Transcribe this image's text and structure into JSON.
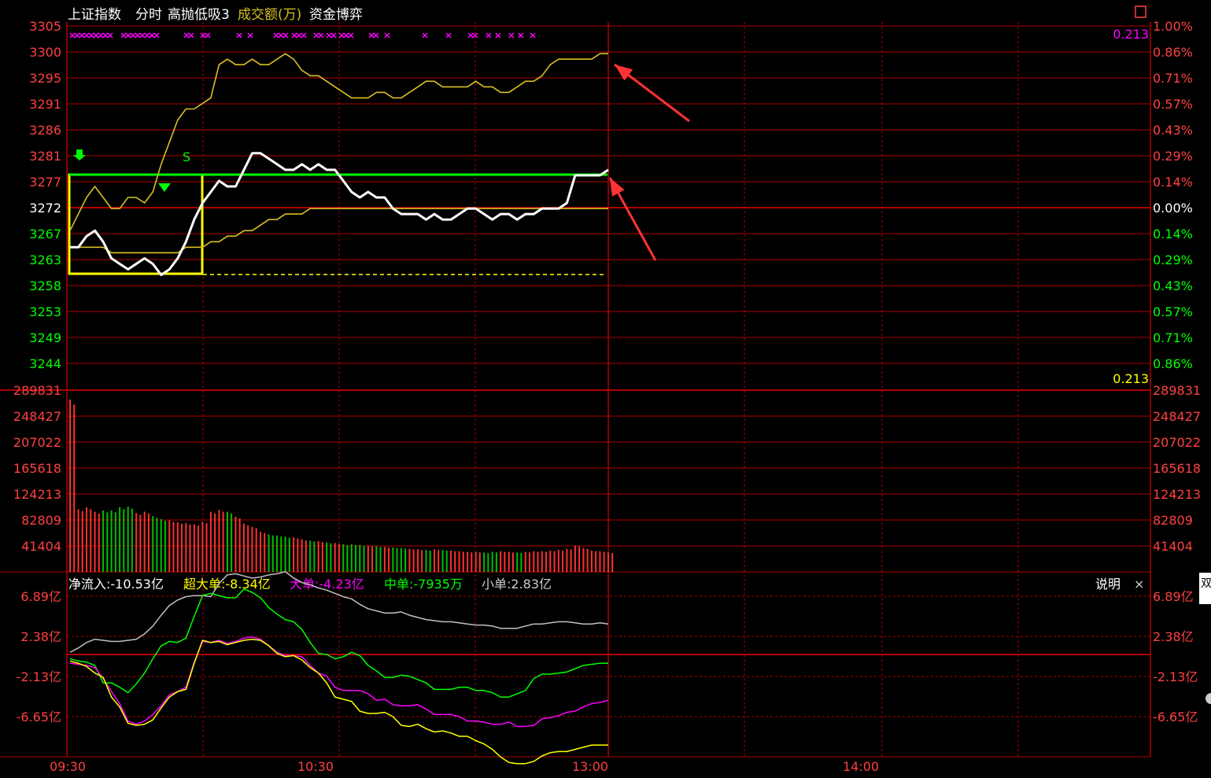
{
  "header": {
    "index_name": "上证指数",
    "mode": "分时",
    "indicator": "高抛低吸3",
    "volume_label": "成交额(万)",
    "indicator2": "资金博弈",
    "corner_icon": "restore-icon"
  },
  "price_panel": {
    "left_ticks": [
      "3305",
      "3300",
      "3295",
      "3291",
      "3286",
      "3281",
      "3277",
      "3272",
      "3267",
      "3263",
      "3258",
      "3253",
      "3249",
      "3244"
    ],
    "right_ticks": [
      "1.00%",
      "0.86%",
      "0.71%",
      "0.57%",
      "0.43%",
      "0.29%",
      "0.14%",
      "0.00%",
      "0.14%",
      "0.29%",
      "0.43%",
      "0.57%",
      "0.71%",
      "0.86%"
    ],
    "indicator_value_top": "0.213",
    "indicator_value_mid": "0.213",
    "signal_s": "S"
  },
  "volume_panel": {
    "ticks": [
      "289831",
      "248427",
      "207022",
      "165618",
      "124213",
      "82809",
      "41404"
    ]
  },
  "flow_panel": {
    "legend": {
      "net": "净流入:-10.53亿",
      "super": "超大单:-8.34亿",
      "large": "大单:-4.23亿",
      "medium": "中单:-7935万",
      "small": "小单:2.83亿"
    },
    "ticks": [
      "6.89亿",
      "2.38亿",
      "-2.13亿",
      "-6.65亿"
    ],
    "explain_label": "说明",
    "close_label": "×",
    "edge_label": "双"
  },
  "time_axis": [
    "09:30",
    "10:30",
    "13:00",
    "14:00"
  ],
  "colors": {
    "grid": "#b00000",
    "price_line": "#ffffff",
    "avg_line": "#d8c020",
    "index_line": "#d8c020",
    "green": "#00ff00",
    "yellow": "#ffff00",
    "magenta": "#ff00ff",
    "red_text": "#ff4040",
    "volume_up": "#ff3030",
    "volume_down": "#00c000",
    "flow_gray": "#c0c0c0",
    "arrow": "#ff3333"
  },
  "chart_data": {
    "type": "line",
    "title": "上证指数 分时",
    "x_labels": [
      "09:30",
      "10:30",
      "13:00",
      "14:00"
    ],
    "price_range": [
      3244,
      3305
    ],
    "base_price": 3272,
    "series": [
      {
        "name": "price",
        "values": [
          3265,
          3265,
          3267,
          3268,
          3266,
          3263,
          3262,
          3261,
          3262,
          3263,
          3262,
          3260,
          3261,
          3263,
          3266,
          3270,
          3273,
          3275,
          3277,
          3276,
          3276,
          3279,
          3282,
          3282,
          3281,
          3280,
          3279,
          3279,
          3280,
          3279,
          3280,
          3279,
          3279,
          3277,
          3275,
          3274,
          3275,
          3274,
          3274,
          3272,
          3271,
          3271,
          3271,
          3270,
          3271,
          3270,
          3270,
          3271,
          3272,
          3272,
          3271,
          3270,
          3271,
          3271,
          3270,
          3271,
          3271,
          3272,
          3272,
          3272,
          3273,
          3278,
          3278,
          3278,
          3278,
          3279
        ]
      },
      {
        "name": "avg",
        "values": [
          3265,
          3265,
          3265,
          3265,
          3265,
          3264,
          3264,
          3264,
          3264,
          3264,
          3264,
          3264,
          3264,
          3264,
          3265,
          3265,
          3265,
          3266,
          3266,
          3267,
          3267,
          3268,
          3268,
          3269,
          3270,
          3270,
          3271,
          3271,
          3271,
          3272,
          3272,
          3272,
          3272,
          3272,
          3272,
          3272,
          3272,
          3272,
          3272,
          3272,
          3272,
          3272,
          3272,
          3272,
          3272,
          3272,
          3272,
          3272,
          3272,
          3272,
          3272,
          3272,
          3272,
          3272,
          3272,
          3272,
          3272,
          3272,
          3272,
          3272,
          3272,
          3272,
          3272,
          3272,
          3272,
          3272
        ]
      },
      {
        "name": "indicator",
        "values": [
          3268,
          3271,
          3274,
          3276,
          3274,
          3272,
          3272,
          3274,
          3274,
          3273,
          3275,
          3280,
          3284,
          3288,
          3290,
          3290,
          3291,
          3292,
          3298,
          3299,
          3298,
          3298,
          3299,
          3298,
          3298,
          3299,
          3300,
          3299,
          3297,
          3296,
          3296,
          3295,
          3294,
          3293,
          3292,
          3292,
          3292,
          3293,
          3293,
          3292,
          3292,
          3293,
          3294,
          3295,
          3295,
          3294,
          3294,
          3294,
          3294,
          3295,
          3294,
          3294,
          3293,
          3293,
          3294,
          3295,
          3295,
          3296,
          3298,
          3299,
          3299,
          3299,
          3299,
          3299,
          3300,
          3300
        ]
      }
    ],
    "volume": [
      275000,
      100000,
      103000,
      96000,
      98000,
      98000,
      103000,
      104000,
      94000,
      96000,
      89000,
      84000,
      82000,
      79000,
      78000,
      76000,
      80000,
      96000,
      99000,
      96000,
      88000,
      77000,
      72000,
      64000,
      60000,
      58000,
      56000,
      55000,
      52000,
      50000,
      49000,
      47000,
      46000,
      44000,
      44000,
      43000,
      42000,
      41000,
      40000,
      39000,
      38000,
      37000,
      36000,
      35000,
      36000,
      35000,
      34000,
      33000,
      32000,
      32000,
      31000,
      32000,
      33000,
      32000,
      31000,
      32000,
      33000,
      33000,
      34000,
      35000,
      37000,
      42000,
      38000,
      34000,
      33000,
      31000
    ],
    "volume_ticks": [
      41404,
      82809,
      124213,
      165618,
      207022,
      248427,
      289831
    ],
    "flow_range": [
      -9,
      9
    ],
    "flow_series": [
      {
        "name": "小单",
        "values": [
          0.2,
          0.6,
          1.1,
          1.4,
          1.3,
          1.2,
          1.2,
          1.3,
          1.4,
          1.9,
          2.6,
          3.6,
          4.5,
          5.0,
          5.3,
          5.4,
          5.4,
          5.3,
          6.5,
          7.3,
          7.4,
          7.2,
          7.0,
          7.1,
          7.3,
          7.4,
          7.6,
          7.0,
          6.6,
          6.4,
          6.1,
          5.9,
          5.6,
          5.3,
          5.1,
          4.6,
          4.2,
          4.0,
          3.8,
          3.8,
          3.9,
          3.6,
          3.4,
          3.2,
          3.1,
          3.0,
          3.0,
          2.9,
          2.8,
          2.7,
          2.7,
          2.6,
          2.4,
          2.4,
          2.4,
          2.6,
          2.8,
          2.8,
          2.9,
          3.0,
          3.0,
          2.9,
          2.8,
          2.8,
          2.9,
          2.8
        ]
      },
      {
        "name": "中单",
        "values": [
          -0.4,
          -0.6,
          -0.7,
          -1.0,
          -2.6,
          -2.6,
          -3.0,
          -3.5,
          -2.7,
          -1.7,
          -0.4,
          0.8,
          1.2,
          1.1,
          1.5,
          3.5,
          5.4,
          5.6,
          5.4,
          5.2,
          5.2,
          6.0,
          5.7,
          5.2,
          4.3,
          3.7,
          3.2,
          3.0,
          2.3,
          1.1,
          0.1,
          0.0,
          -0.4,
          -0.2,
          0.2,
          -0.1,
          -1.0,
          -1.5,
          -2.1,
          -2.1,
          -1.9,
          -2.0,
          -2.3,
          -2.6,
          -3.2,
          -3.2,
          -3.2,
          -3.0,
          -3.0,
          -3.3,
          -3.3,
          -3.5,
          -3.9,
          -3.9,
          -3.6,
          -3.3,
          -2.2,
          -1.8,
          -1.8,
          -1.7,
          -1.6,
          -1.3,
          -1.0,
          -0.9,
          -0.8,
          -0.8
        ]
      },
      {
        "name": "大单",
        "values": [
          -0.8,
          -0.9,
          -1.0,
          -1.2,
          -2.2,
          -3.4,
          -4.5,
          -6.1,
          -6.4,
          -6.1,
          -5.5,
          -4.7,
          -3.7,
          -3.4,
          -3.0,
          -0.7,
          1.2,
          1.1,
          1.3,
          1.0,
          1.2,
          1.5,
          1.6,
          1.4,
          0.8,
          0.2,
          -0.1,
          -0.1,
          -0.2,
          -1.0,
          -1.7,
          -2.0,
          -3.0,
          -3.3,
          -3.3,
          -3.3,
          -3.6,
          -4.2,
          -4.1,
          -4.6,
          -4.7,
          -4.7,
          -4.6,
          -5.0,
          -5.5,
          -5.5,
          -5.5,
          -5.7,
          -6.1,
          -6.1,
          -6.2,
          -6.4,
          -6.4,
          -6.2,
          -6.6,
          -6.6,
          -6.5,
          -5.9,
          -5.8,
          -5.6,
          -5.3,
          -5.2,
          -4.8,
          -4.5,
          -4.4,
          -4.2
        ]
      },
      {
        "name": "超大单",
        "values": [
          -0.6,
          -0.8,
          -1.1,
          -1.7,
          -2.1,
          -3.9,
          -4.8,
          -6.3,
          -6.5,
          -6.4,
          -6.0,
          -4.9,
          -3.9,
          -3.4,
          -3.2,
          -0.8,
          1.3,
          1.1,
          1.2,
          0.9,
          1.1,
          1.3,
          1.4,
          1.3,
          0.8,
          0.1,
          -0.2,
          -0.1,
          -0.5,
          -1.2,
          -1.7,
          -2.6,
          -3.9,
          -4.1,
          -4.3,
          -5.2,
          -5.4,
          -5.4,
          -5.3,
          -5.7,
          -6.5,
          -6.6,
          -6.4,
          -6.8,
          -7.1,
          -7.0,
          -7.2,
          -7.5,
          -7.5,
          -7.9,
          -8.2,
          -8.7,
          -9.4,
          -9.9,
          -10.0,
          -10.0,
          -9.8,
          -9.3,
          -9.0,
          -8.9,
          -8.9,
          -8.7,
          -8.5,
          -8.3,
          -8.3,
          -8.3
        ]
      }
    ],
    "flow_ticks": [
      "6.89亿",
      "2.38亿",
      "-2.13亿",
      "-6.65亿"
    ]
  }
}
